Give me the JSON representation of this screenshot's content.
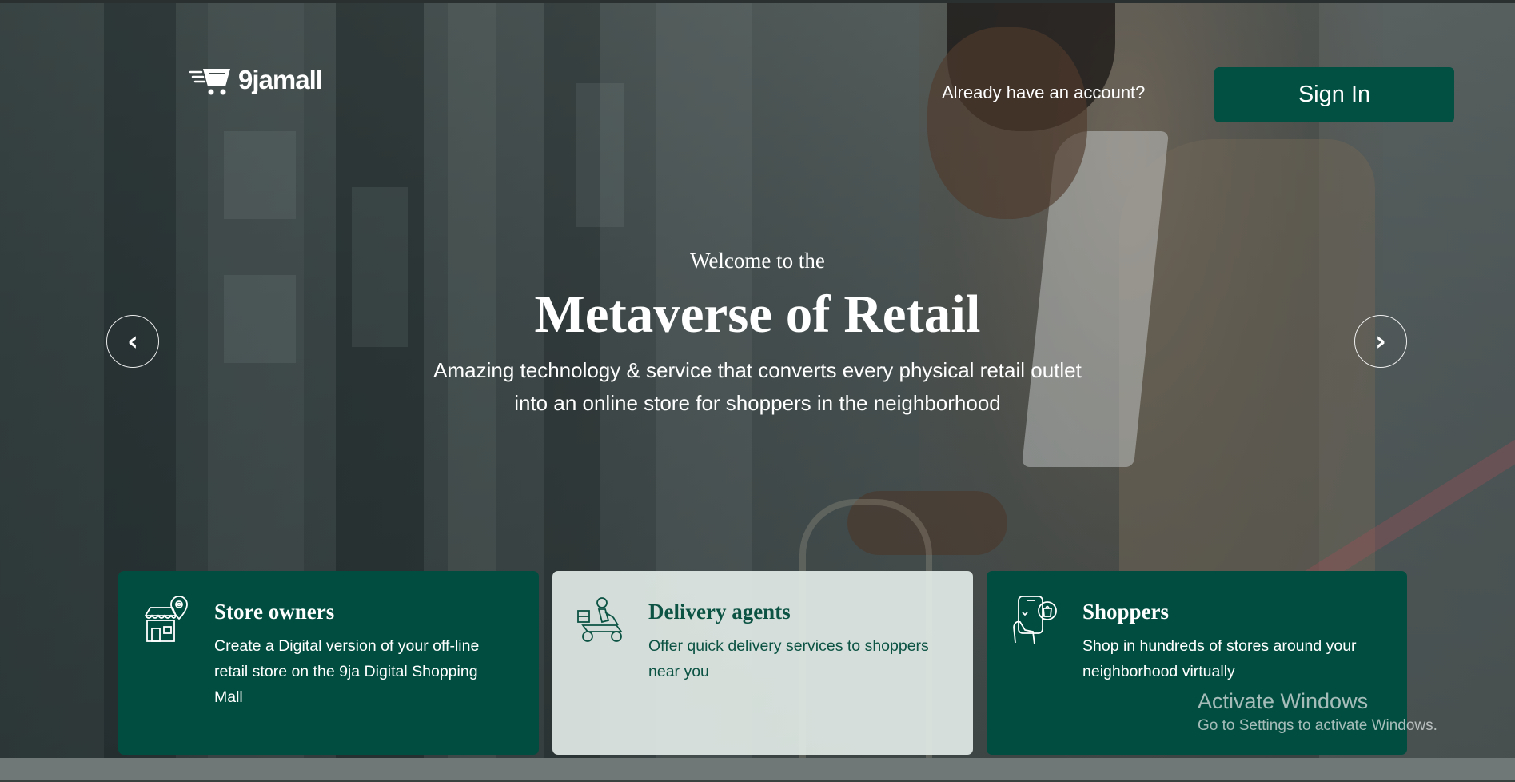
{
  "header": {
    "logo_text": "9jamall",
    "account_prompt": "Already have an account?",
    "signin_label": "Sign In"
  },
  "hero": {
    "welcome": "Welcome to the",
    "headline": "Metaverse of Retail",
    "subtext": "Amazing technology & service that converts every physical retail outlet into an online store for shoppers in the neighborhood",
    "prev_label": "‹",
    "next_label": "›"
  },
  "cards": [
    {
      "title": "Store owners",
      "description": "Create a Digital version of your off-line retail store on the 9ja Digital Shopping Mall",
      "icon": "store-location-icon"
    },
    {
      "title": "Delivery agents",
      "description": "Offer quick delivery services to shoppers near you",
      "icon": "delivery-scooter-icon"
    },
    {
      "title": "Shoppers",
      "description": "Shop in hundreds of stores around your neighborhood virtually",
      "icon": "phone-shopping-icon"
    }
  ],
  "watermark": {
    "title": "Activate Windows",
    "subtitle": "Go to Settings to activate Windows."
  },
  "colors": {
    "brand_green": "#025042",
    "card_dark": "#014e40",
    "card_light": "#e6eeea"
  }
}
